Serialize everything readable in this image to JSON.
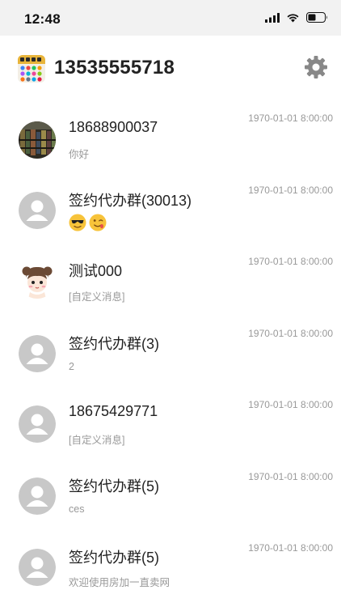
{
  "status_bar": {
    "time": "12:48"
  },
  "header": {
    "phone": "13535555718"
  },
  "conversations": [
    {
      "name": "18688900037",
      "time": "1970-01-01 8:00:00",
      "message": "你好",
      "avatar": "photo"
    },
    {
      "name": "签约代办群(30013)",
      "time": "1970-01-01 8:00:00",
      "message": "",
      "avatar": "default"
    },
    {
      "name": "测试000",
      "time": "1970-01-01 8:00:00",
      "message": "[自定义消息]",
      "avatar": "girl"
    },
    {
      "name": "签约代办群(3)",
      "time": "1970-01-01 8:00:00",
      "message": "2",
      "avatar": "default"
    },
    {
      "name": "18675429771",
      "time": "1970-01-01 8:00:00",
      "message": "[自定义消息]",
      "avatar": "default"
    },
    {
      "name": "签约代办群(5)",
      "time": "1970-01-01 8:00:00",
      "message": "ces",
      "avatar": "default"
    },
    {
      "name": "签约代办群(5)",
      "time": "1970-01-01 8:00:00",
      "message": "欢迎使用房加一直卖网",
      "avatar": "default"
    }
  ],
  "icons": {
    "settings": "gear-icon",
    "default_avatar": "user-icon",
    "emoji_1": "sunglasses-emoji",
    "emoji_2": "wink-emoji"
  },
  "colors": {
    "text": "#222222",
    "muted": "#999999",
    "avatar_bg": "#c8c8c8",
    "gear": "#888888",
    "status_bg": "#f2f2f2"
  }
}
